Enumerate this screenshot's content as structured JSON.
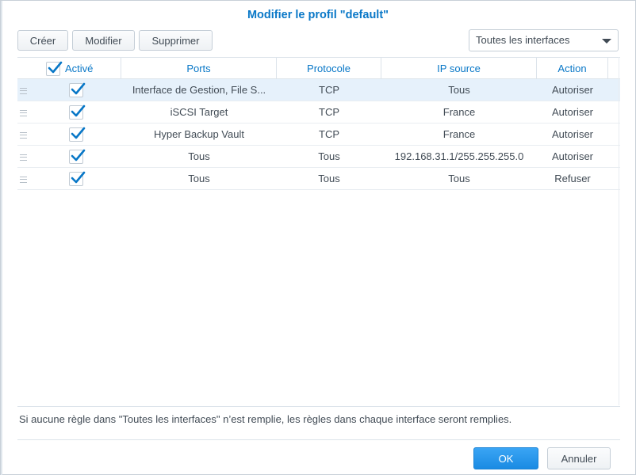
{
  "dialog": {
    "title": "Modifier le profil \"default\""
  },
  "toolbar": {
    "create_label": "Créer",
    "edit_label": "Modifier",
    "delete_label": "Supprimer"
  },
  "interface_select": {
    "selected": "Toutes les interfaces"
  },
  "table": {
    "columns": {
      "active": "Activé",
      "ports": "Ports",
      "protocol": "Protocole",
      "source_ip": "IP source",
      "action": "Action"
    },
    "header_checked": true,
    "rows": [
      {
        "checked": true,
        "ports": "Interface de Gestion, File S...",
        "protocol": "TCP",
        "source_ip": "Tous",
        "action": "Autoriser",
        "selected": true
      },
      {
        "checked": true,
        "ports": "iSCSI Target",
        "protocol": "TCP",
        "source_ip": "France",
        "action": "Autoriser",
        "selected": false
      },
      {
        "checked": true,
        "ports": "Hyper Backup Vault",
        "protocol": "TCP",
        "source_ip": "France",
        "action": "Autoriser",
        "selected": false
      },
      {
        "checked": true,
        "ports": "Tous",
        "protocol": "Tous",
        "source_ip": "192.168.31.1/255.255.255.0",
        "action": "Autoriser",
        "selected": false
      },
      {
        "checked": true,
        "ports": "Tous",
        "protocol": "Tous",
        "source_ip": "Tous",
        "action": "Refuser",
        "selected": false
      }
    ]
  },
  "note": "Si aucune règle dans \"Toutes les interfaces\" n’est remplie, les règles dans chaque interface seront remplies.",
  "buttons": {
    "ok_label": "OK",
    "cancel_label": "Annuler"
  },
  "colors": {
    "accent": "#0877c7",
    "selected_row": "#e6f1fb",
    "primary_button": "#1a8be3"
  }
}
